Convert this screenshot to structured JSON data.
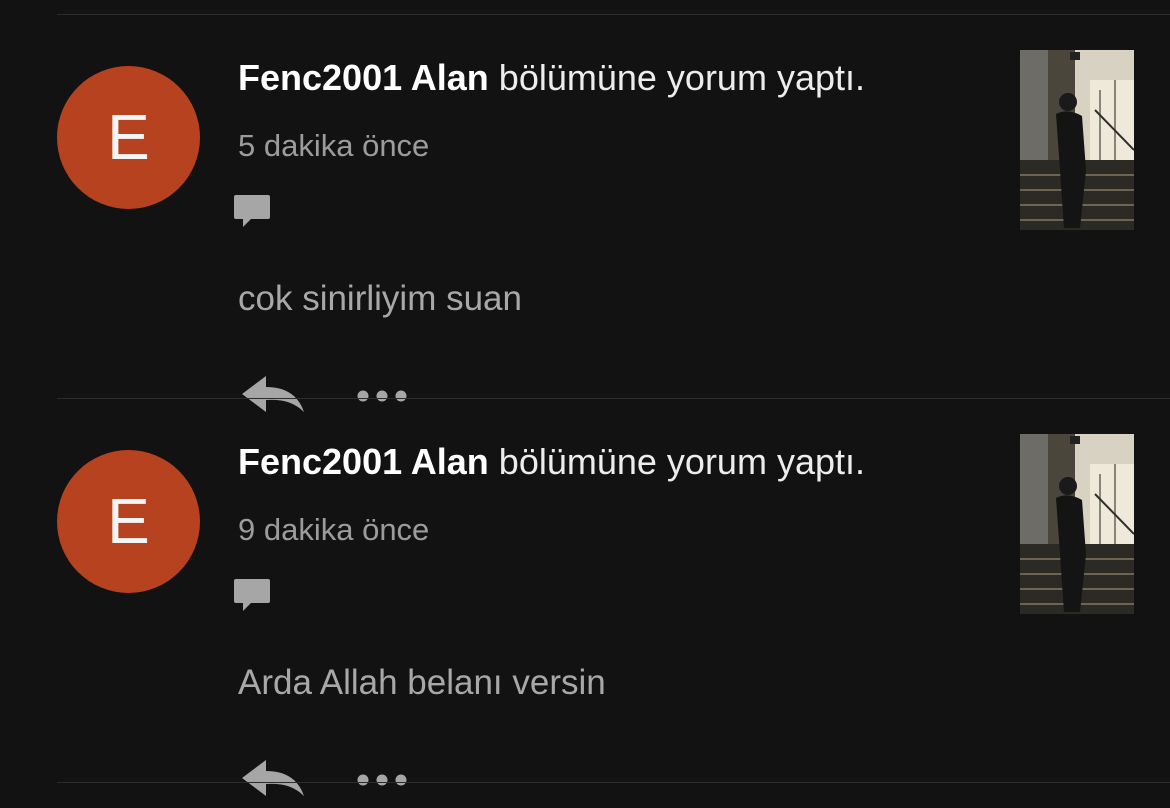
{
  "notifications": [
    {
      "avatar_letter": "E",
      "username": "Fenc2001 Alan",
      "action": " bölümüne yorum yaptı.",
      "time": "5 dakika önce",
      "comment": "cok sinirliyim suan",
      "icons": {
        "type": "comment-bubble-icon",
        "reply": "reply-arrow-icon",
        "more": "more-dots-icon"
      }
    },
    {
      "avatar_letter": "E",
      "username": "Fenc2001 Alan",
      "action": " bölümüne yorum yaptı.",
      "time": "9 dakika önce",
      "comment": "Arda Allah belanı versin",
      "icons": {
        "type": "comment-bubble-icon",
        "reply": "reply-arrow-icon",
        "more": "more-dots-icon"
      }
    }
  ],
  "colors": {
    "background": "#121212",
    "avatar": "#b7421f",
    "divider": "#2c2c2c",
    "secondary_text": "#9c9c9c",
    "icon": "#a6a6a6"
  }
}
